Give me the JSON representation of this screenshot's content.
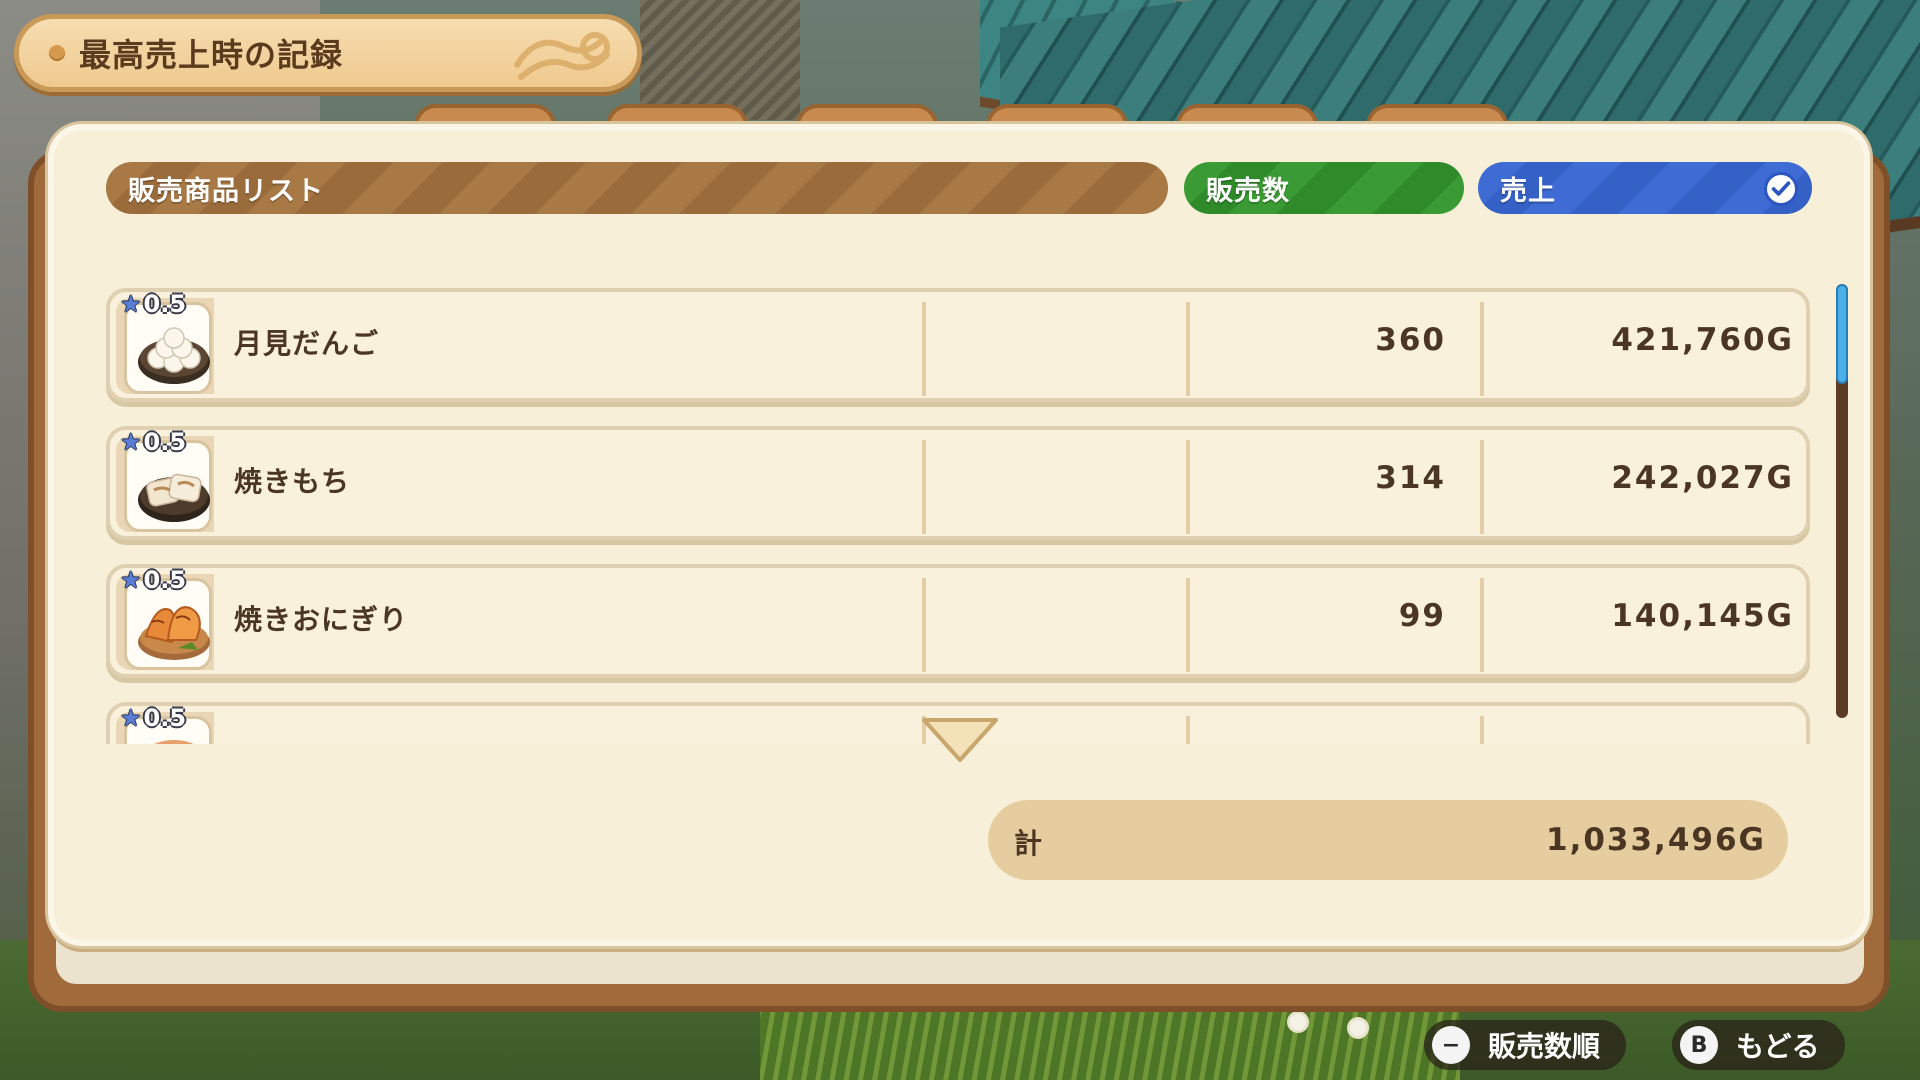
{
  "title": "最高売上時の記録",
  "header": {
    "list_label": "販売商品リスト",
    "count_label": "販売数",
    "sales_label": "売上"
  },
  "rows": [
    {
      "rarity": "0.5",
      "name": "月見だんご",
      "icon": "tsukimi-dango-icon",
      "count": "360",
      "sales": "421,760G"
    },
    {
      "rarity": "0.5",
      "name": "焼きもち",
      "icon": "yakimochi-icon",
      "count": "314",
      "sales": "242,027G"
    },
    {
      "rarity": "0.5",
      "name": "焼きおにぎり",
      "icon": "yaki-onigiri-icon",
      "count": "99",
      "sales": "140,145G"
    },
    {
      "rarity": "0.5",
      "name": "",
      "icon": "partial-item-icon",
      "count": "",
      "sales": ""
    }
  ],
  "total": {
    "label": "計",
    "value": "1,033,496G"
  },
  "hints": [
    {
      "button": "−",
      "label": "販売数順"
    },
    {
      "button": "B",
      "label": "もどる"
    }
  ],
  "colors": {
    "list_header": "#a57543",
    "count_header": "#3a9a33",
    "sales_header": "#3e6bd4",
    "panel": "#f7efd8",
    "text": "#4a3623"
  }
}
